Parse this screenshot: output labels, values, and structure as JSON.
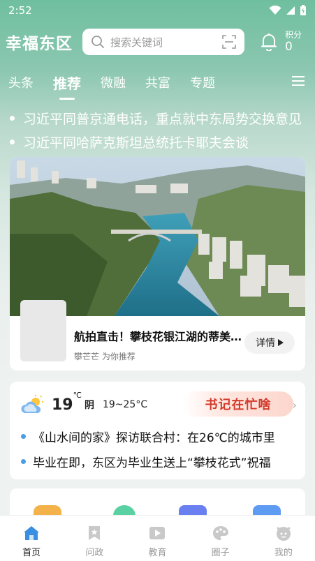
{
  "status_bar": {
    "time": "2:52"
  },
  "header": {
    "app_title": "幸福东区",
    "search_placeholder": "搜索关键词",
    "points_label": "积分",
    "points_value": "0"
  },
  "tabs": [
    {
      "label": "头条",
      "active": false
    },
    {
      "label": "推荐",
      "active": true
    },
    {
      "label": "微融",
      "active": false
    },
    {
      "label": "共富",
      "active": false
    },
    {
      "label": "专题",
      "active": false
    }
  ],
  "headlines": [
    "习近平同普京通电话，重点就中东局势交换意见",
    "习近平同哈萨克斯坦总统托卡耶夫会谈"
  ],
  "video_card": {
    "title": "航拍直击！攀枝花银江湖的蒂美景色",
    "subtitle": "攀芒芒 为你推荐",
    "detail_label": "详情"
  },
  "weather": {
    "temperature": "19",
    "unit": "℃",
    "condition": "阴",
    "range": "19~25°C",
    "promo_text": "书记在忙啥"
  },
  "news_items": [
    "《山水间的家》探访联合村：在26℃的城市里",
    "毕业在即，东区为毕业生送上“攀枝花式”祝福"
  ],
  "bottom_nav": [
    {
      "label": "首页",
      "icon": "home-icon",
      "active": true
    },
    {
      "label": "问政",
      "icon": "bookmark-icon",
      "active": false
    },
    {
      "label": "教育",
      "icon": "play-icon",
      "active": false
    },
    {
      "label": "圈子",
      "icon": "palette-icon",
      "active": false
    },
    {
      "label": "我的",
      "icon": "profile-icon",
      "active": false
    }
  ],
  "colors": {
    "accent_green": "#6fbf9f",
    "promo_red": "#d23b2c",
    "bullet_blue": "#4a9ee8",
    "nav_active": "#3a8fe0"
  }
}
